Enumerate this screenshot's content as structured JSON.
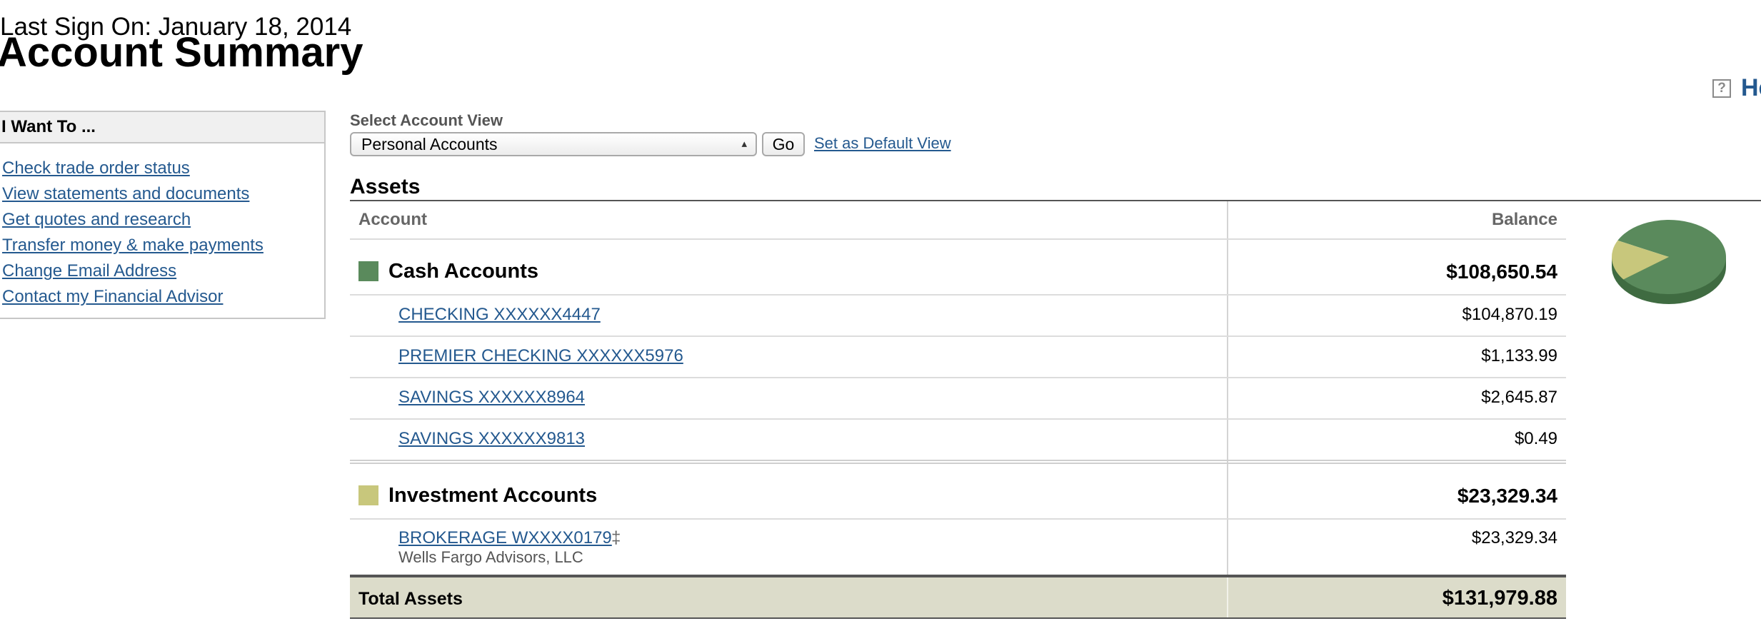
{
  "header": {
    "last_sign_on": "Last Sign On: January 18, 2014",
    "page_title": "Account Summary",
    "help_label": "He"
  },
  "i_want_to": {
    "title": "I Want To ...",
    "links": [
      "Check trade order status",
      "View statements and documents",
      "Get quotes and research",
      "Transfer money & make payments",
      "Change Email Address",
      "Contact my Financial Advisor"
    ]
  },
  "account_view": {
    "label": "Select Account View",
    "selected": "Personal Accounts",
    "go_label": "Go",
    "default_link": "Set as Default View"
  },
  "assets": {
    "title": "Assets",
    "columns": {
      "account": "Account",
      "balance": "Balance"
    },
    "categories": [
      {
        "name": "Cash Accounts",
        "total": "$108,650.54",
        "color": "#5a8a5c",
        "accounts": [
          {
            "name": "CHECKING XXXXXX4447",
            "balance": "$104,870.19"
          },
          {
            "name": "PREMIER CHECKING XXXXXX5976",
            "balance": "$1,133.99"
          },
          {
            "name": "SAVINGS XXXXXX8964",
            "balance": "$2,645.87"
          },
          {
            "name": "SAVINGS XXXXXX9813",
            "balance": "$0.49"
          }
        ]
      },
      {
        "name": "Investment Accounts",
        "total": "$23,329.34",
        "color": "#c8c77c",
        "accounts": [
          {
            "name": "BROKERAGE WXXXX0179",
            "marker": "‡",
            "sub": "Wells Fargo Advisors, LLC",
            "balance": "$23,329.34"
          }
        ]
      }
    ],
    "total_label": "Total Assets",
    "total_value": "$131,979.88"
  },
  "pie_chart": {
    "slices": [
      {
        "category": "Cash Accounts",
        "value": 108650.54,
        "color": "#5a8a5c"
      },
      {
        "category": "Investment Accounts",
        "value": 23329.34,
        "color": "#c8c77c"
      }
    ]
  }
}
